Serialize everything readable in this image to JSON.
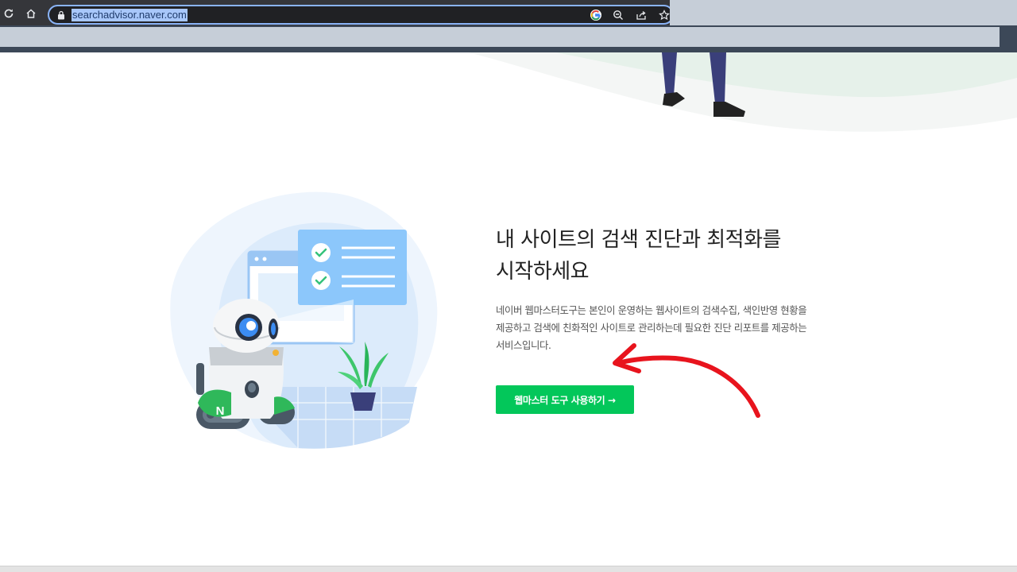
{
  "browser": {
    "url": "searchadvisor.naver.com",
    "reload_icon": "reload-icon",
    "home_icon": "home-icon",
    "lock_icon": "lock-icon",
    "google_icon": "google-icon",
    "zoom_icon": "zoom-out-icon",
    "share_icon": "share-icon",
    "bookmark_icon": "star-icon"
  },
  "hero": {
    "headline_line1": "내 사이트의 검색 진단과 최적화를",
    "headline_line2": "시작하세요",
    "description_line1": "네이버 웹마스터도구는 본인이 운영하는 웹사이트의 검색수집, 색인반영 현황을",
    "description_line2": "제공하고 검색에 친화적인 사이트로 관리하는데 필요한 진단 리포트를 제공하는",
    "description_line3": "서비스입니다.",
    "cta_label": "웹마스터 도구 사용하기 →"
  },
  "colors": {
    "brand_green": "#03c75a",
    "annotation_red": "#e8141d",
    "chrome_dark": "#35363a"
  }
}
